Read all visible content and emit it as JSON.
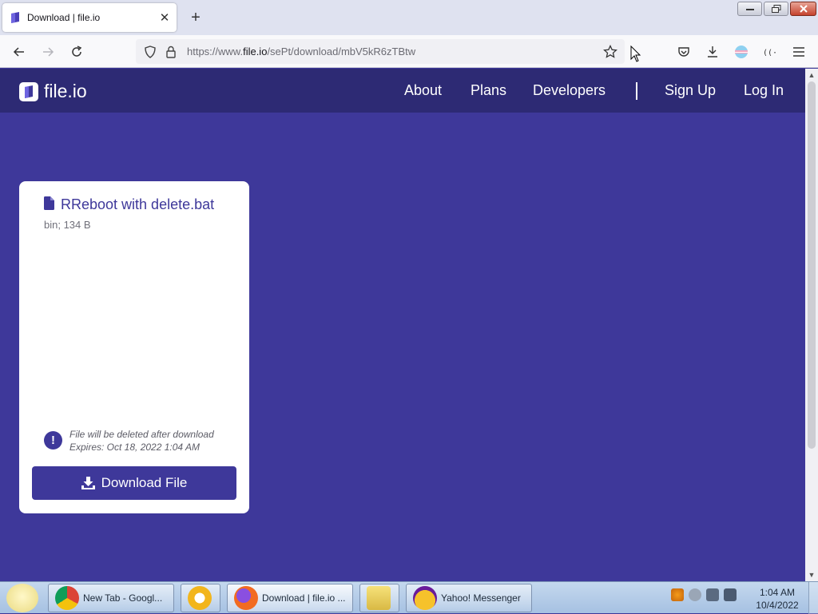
{
  "browser": {
    "tab_title": "Download | file.io",
    "url_prefix": "https://www.",
    "url_domain": "file.io",
    "url_path": "/sePt/download/mbV5kR6zTBtw"
  },
  "site": {
    "logo_text": "file.io",
    "nav": {
      "about": "About",
      "plans": "Plans",
      "developers": "Developers",
      "signup": "Sign Up",
      "login": "Log In"
    }
  },
  "file": {
    "name": "RReboot with delete.bat",
    "meta": "bin; 134 B",
    "notice_line1": "File will be deleted after download",
    "notice_line2": "Expires: Oct 18, 2022 1:04 AM",
    "download_label": "Download File"
  },
  "taskbar": {
    "items": [
      {
        "label": "New Tab - Googl..."
      },
      {
        "label": "Download | file.io ..."
      },
      {
        "label": "Yahoo! Messenger"
      }
    ],
    "time": "1:04 AM",
    "date": "10/4/2022"
  },
  "colors": {
    "brand": "#3e389a",
    "header": "#2d2a74"
  }
}
